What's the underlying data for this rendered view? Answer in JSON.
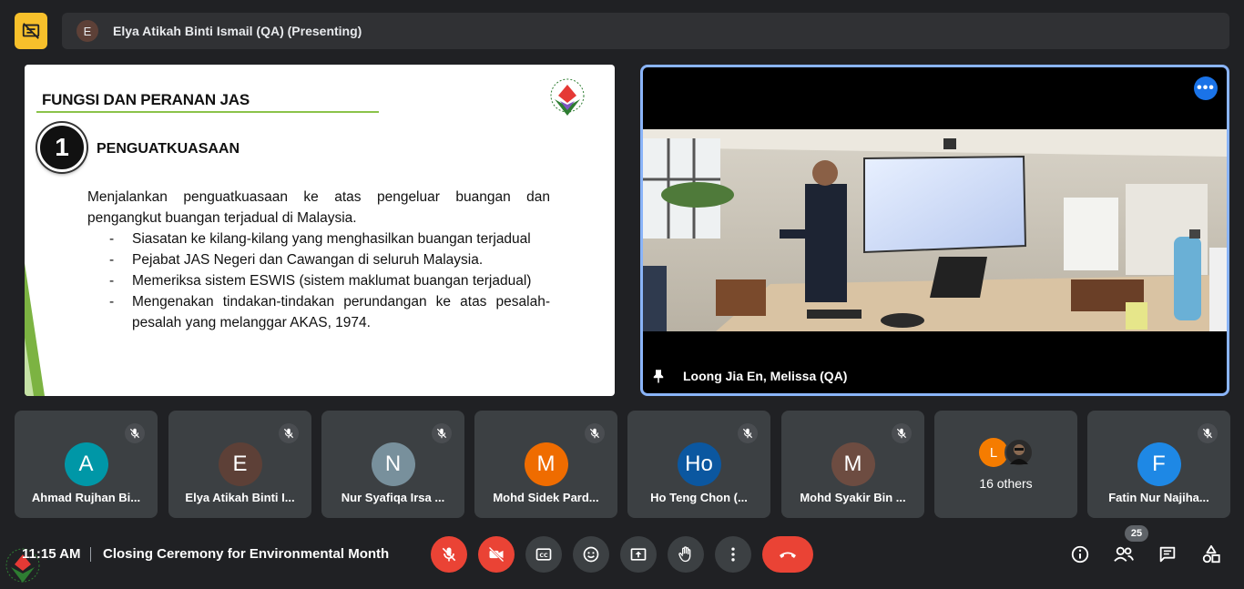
{
  "presenter_bar": {
    "avatar_letter": "E",
    "name": "Elya Atikah Binti Ismail (QA) (Presenting)"
  },
  "slide": {
    "title": "FUNGSI DAN PERANAN JAS",
    "number": "1",
    "heading": "PENGUATKUASAAN",
    "paragraph": "Menjalankan penguatkuasaan ke atas pengeluar buangan dan pengangkut buangan terjadual di Malaysia.",
    "bullets": [
      "Siasatan ke kilang-kilang yang menghasilkan buangan terjadual",
      "Pejabat JAS Negeri dan Cawangan di seluruh Malaysia.",
      "Memeriksa sistem ESWIS (sistem maklumat buangan terjadual)",
      "Mengenakan tindakan-tindakan perundangan ke atas pesalah-pesalah yang melanggar AKAS, 1974."
    ],
    "bullet_marker": "-"
  },
  "camera": {
    "name": "Loong Jia En, Melissa (QA)",
    "more_label": "•••"
  },
  "participants": [
    {
      "letter": "A",
      "name": "Ahmad Rujhan Bi...",
      "color": "#0097a7"
    },
    {
      "letter": "E",
      "name": "Elya Atikah Binti I...",
      "color": "#5d4037"
    },
    {
      "letter": "N",
      "name": "Nur Syafiqa Irsa ...",
      "color": "#78909c"
    },
    {
      "letter": "M",
      "name": "Mohd Sidek Pard...",
      "color": "#ef6c00"
    },
    {
      "letter": "Ho",
      "name": "Ho Teng Chon (...",
      "color": "#0b57a0"
    },
    {
      "letter": "M",
      "name": "Mohd Syakir Bin ...",
      "color": "#6d4c41"
    },
    {
      "letter": "F",
      "name": "Fatin Nur Najiha...",
      "color": "#1e88e5"
    }
  ],
  "others": {
    "letter": "L",
    "letter_color": "#f57c00",
    "label": "16 others"
  },
  "bottom": {
    "time": "11:15 AM",
    "meeting_title": "Closing Ceremony for Environmental Month",
    "participant_count": "25"
  },
  "colors": {
    "accent_yellow": "#f7c02b",
    "active_border": "#8ab4f8",
    "danger": "#ea4335",
    "tile_bg": "#3c4043",
    "bg": "#202124"
  }
}
